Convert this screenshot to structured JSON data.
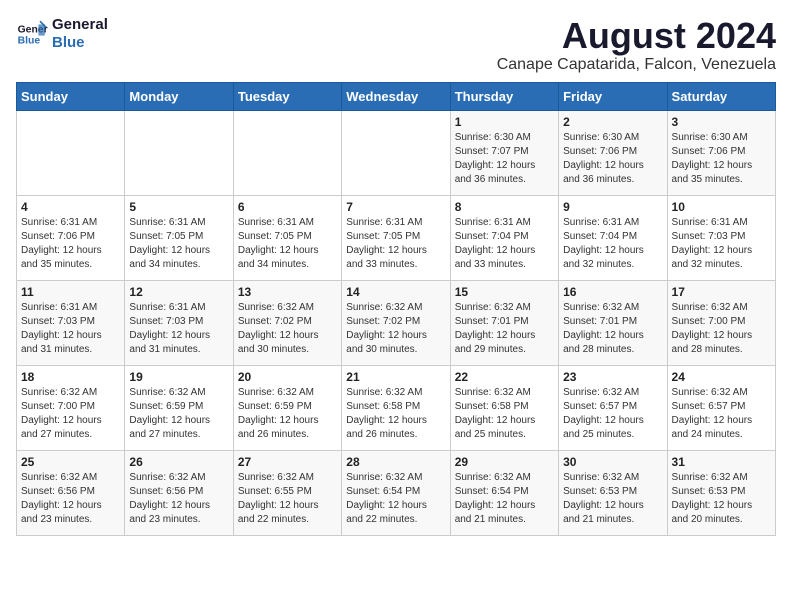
{
  "logo": {
    "line1": "General",
    "line2": "Blue"
  },
  "title": "August 2024",
  "subtitle": "Canape Capatarida, Falcon, Venezuela",
  "weekdays": [
    "Sunday",
    "Monday",
    "Tuesday",
    "Wednesday",
    "Thursday",
    "Friday",
    "Saturday"
  ],
  "weeks": [
    [
      {
        "day": "",
        "info": ""
      },
      {
        "day": "",
        "info": ""
      },
      {
        "day": "",
        "info": ""
      },
      {
        "day": "",
        "info": ""
      },
      {
        "day": "1",
        "info": "Sunrise: 6:30 AM\nSunset: 7:07 PM\nDaylight: 12 hours\nand 36 minutes."
      },
      {
        "day": "2",
        "info": "Sunrise: 6:30 AM\nSunset: 7:06 PM\nDaylight: 12 hours\nand 36 minutes."
      },
      {
        "day": "3",
        "info": "Sunrise: 6:30 AM\nSunset: 7:06 PM\nDaylight: 12 hours\nand 35 minutes."
      }
    ],
    [
      {
        "day": "4",
        "info": "Sunrise: 6:31 AM\nSunset: 7:06 PM\nDaylight: 12 hours\nand 35 minutes."
      },
      {
        "day": "5",
        "info": "Sunrise: 6:31 AM\nSunset: 7:05 PM\nDaylight: 12 hours\nand 34 minutes."
      },
      {
        "day": "6",
        "info": "Sunrise: 6:31 AM\nSunset: 7:05 PM\nDaylight: 12 hours\nand 34 minutes."
      },
      {
        "day": "7",
        "info": "Sunrise: 6:31 AM\nSunset: 7:05 PM\nDaylight: 12 hours\nand 33 minutes."
      },
      {
        "day": "8",
        "info": "Sunrise: 6:31 AM\nSunset: 7:04 PM\nDaylight: 12 hours\nand 33 minutes."
      },
      {
        "day": "9",
        "info": "Sunrise: 6:31 AM\nSunset: 7:04 PM\nDaylight: 12 hours\nand 32 minutes."
      },
      {
        "day": "10",
        "info": "Sunrise: 6:31 AM\nSunset: 7:03 PM\nDaylight: 12 hours\nand 32 minutes."
      }
    ],
    [
      {
        "day": "11",
        "info": "Sunrise: 6:31 AM\nSunset: 7:03 PM\nDaylight: 12 hours\nand 31 minutes."
      },
      {
        "day": "12",
        "info": "Sunrise: 6:31 AM\nSunset: 7:03 PM\nDaylight: 12 hours\nand 31 minutes."
      },
      {
        "day": "13",
        "info": "Sunrise: 6:32 AM\nSunset: 7:02 PM\nDaylight: 12 hours\nand 30 minutes."
      },
      {
        "day": "14",
        "info": "Sunrise: 6:32 AM\nSunset: 7:02 PM\nDaylight: 12 hours\nand 30 minutes."
      },
      {
        "day": "15",
        "info": "Sunrise: 6:32 AM\nSunset: 7:01 PM\nDaylight: 12 hours\nand 29 minutes."
      },
      {
        "day": "16",
        "info": "Sunrise: 6:32 AM\nSunset: 7:01 PM\nDaylight: 12 hours\nand 28 minutes."
      },
      {
        "day": "17",
        "info": "Sunrise: 6:32 AM\nSunset: 7:00 PM\nDaylight: 12 hours\nand 28 minutes."
      }
    ],
    [
      {
        "day": "18",
        "info": "Sunrise: 6:32 AM\nSunset: 7:00 PM\nDaylight: 12 hours\nand 27 minutes."
      },
      {
        "day": "19",
        "info": "Sunrise: 6:32 AM\nSunset: 6:59 PM\nDaylight: 12 hours\nand 27 minutes."
      },
      {
        "day": "20",
        "info": "Sunrise: 6:32 AM\nSunset: 6:59 PM\nDaylight: 12 hours\nand 26 minutes."
      },
      {
        "day": "21",
        "info": "Sunrise: 6:32 AM\nSunset: 6:58 PM\nDaylight: 12 hours\nand 26 minutes."
      },
      {
        "day": "22",
        "info": "Sunrise: 6:32 AM\nSunset: 6:58 PM\nDaylight: 12 hours\nand 25 minutes."
      },
      {
        "day": "23",
        "info": "Sunrise: 6:32 AM\nSunset: 6:57 PM\nDaylight: 12 hours\nand 25 minutes."
      },
      {
        "day": "24",
        "info": "Sunrise: 6:32 AM\nSunset: 6:57 PM\nDaylight: 12 hours\nand 24 minutes."
      }
    ],
    [
      {
        "day": "25",
        "info": "Sunrise: 6:32 AM\nSunset: 6:56 PM\nDaylight: 12 hours\nand 23 minutes."
      },
      {
        "day": "26",
        "info": "Sunrise: 6:32 AM\nSunset: 6:56 PM\nDaylight: 12 hours\nand 23 minutes."
      },
      {
        "day": "27",
        "info": "Sunrise: 6:32 AM\nSunset: 6:55 PM\nDaylight: 12 hours\nand 22 minutes."
      },
      {
        "day": "28",
        "info": "Sunrise: 6:32 AM\nSunset: 6:54 PM\nDaylight: 12 hours\nand 22 minutes."
      },
      {
        "day": "29",
        "info": "Sunrise: 6:32 AM\nSunset: 6:54 PM\nDaylight: 12 hours\nand 21 minutes."
      },
      {
        "day": "30",
        "info": "Sunrise: 6:32 AM\nSunset: 6:53 PM\nDaylight: 12 hours\nand 21 minutes."
      },
      {
        "day": "31",
        "info": "Sunrise: 6:32 AM\nSunset: 6:53 PM\nDaylight: 12 hours\nand 20 minutes."
      }
    ]
  ]
}
